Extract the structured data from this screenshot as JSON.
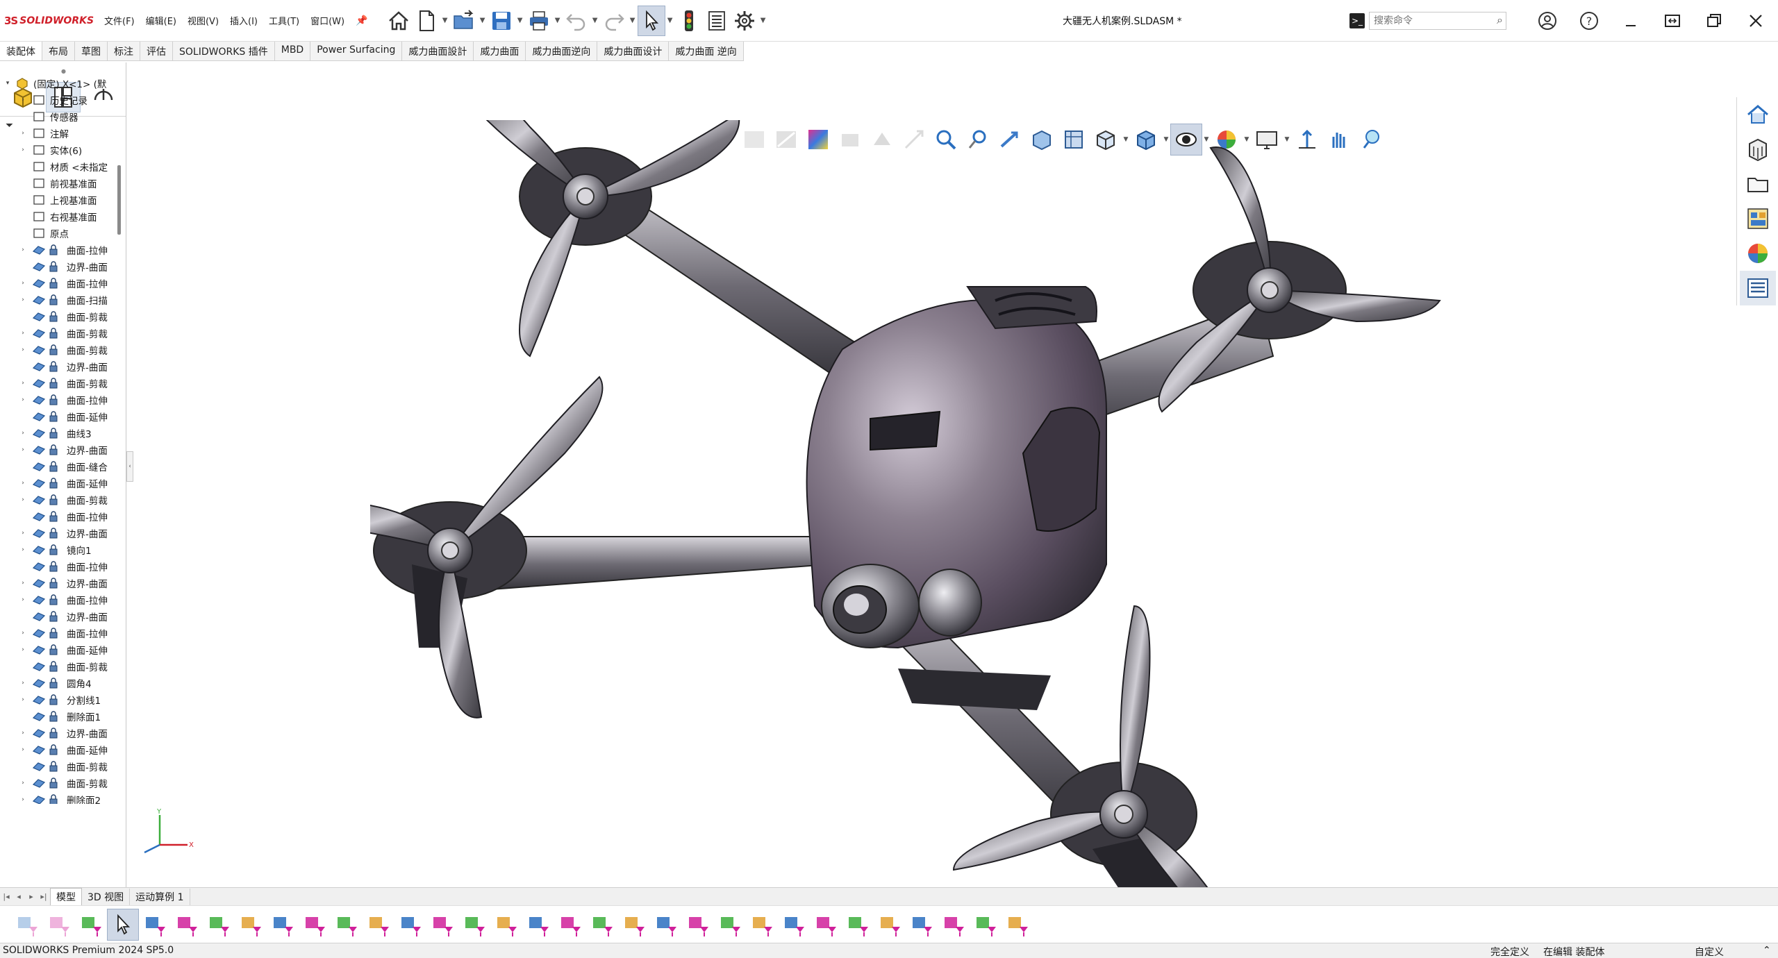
{
  "app": {
    "logo_ds": "3S",
    "logo_text": "SOLIDWORKS",
    "document_title": "大疆无人机案例.SLDASM *"
  },
  "menu": [
    "文件(F)",
    "编辑(E)",
    "视图(V)",
    "插入(I)",
    "工具(T)",
    "窗口(W)"
  ],
  "search": {
    "placeholder": "搜索命令"
  },
  "command_tabs": [
    "装配体",
    "布局",
    "草图",
    "标注",
    "评估",
    "SOLIDWORKS 插件",
    "MBD",
    "Power Surfacing",
    "威力曲面設計",
    "威力曲面",
    "威力曲面逆向",
    "威力曲面设计",
    "威力曲面 逆向"
  ],
  "tree": {
    "root": "(固定) X<1> (默",
    "items": [
      "历史记录",
      "传感器",
      "注解",
      "实体(6)",
      "材质 <未指定",
      "前视基准面",
      "上视基准面",
      "右视基准面",
      "原点",
      "曲面-拉伸",
      "边界-曲面",
      "曲面-拉伸",
      "曲面-扫描",
      "曲面-剪裁",
      "曲面-剪裁",
      "曲面-剪裁",
      "边界-曲面",
      "曲面-剪裁",
      "曲面-拉伸",
      "曲面-延伸",
      "曲线3",
      "边界-曲面",
      "曲面-缝合",
      "曲面-延伸",
      "曲面-剪裁",
      "曲面-拉伸",
      "边界-曲面",
      "镜向1",
      "曲面-拉伸",
      "边界-曲面",
      "曲面-拉伸",
      "边界-曲面",
      "曲面-拉伸",
      "曲面-延伸",
      "曲面-剪裁",
      "圆角4",
      "分割线1",
      "删除面1",
      "边界-曲面",
      "曲面-延伸",
      "曲面-剪裁",
      "曲面-剪裁",
      "删除面2"
    ]
  },
  "bottom_tabs": [
    "模型",
    "3D 视图",
    "运动算例 1"
  ],
  "status": {
    "product": "SOLIDWORKS Premium 2024 SP5.0",
    "definition": "完全定义",
    "editing": "在编辑 装配体",
    "custom": "自定义"
  },
  "axes": {
    "x": "X",
    "y": "Y"
  },
  "colors": {
    "brand": "#d0202a",
    "selected_bg": "#cfd8e6",
    "drone_metal": "#8a8890",
    "drone_body": "#6b6070"
  }
}
